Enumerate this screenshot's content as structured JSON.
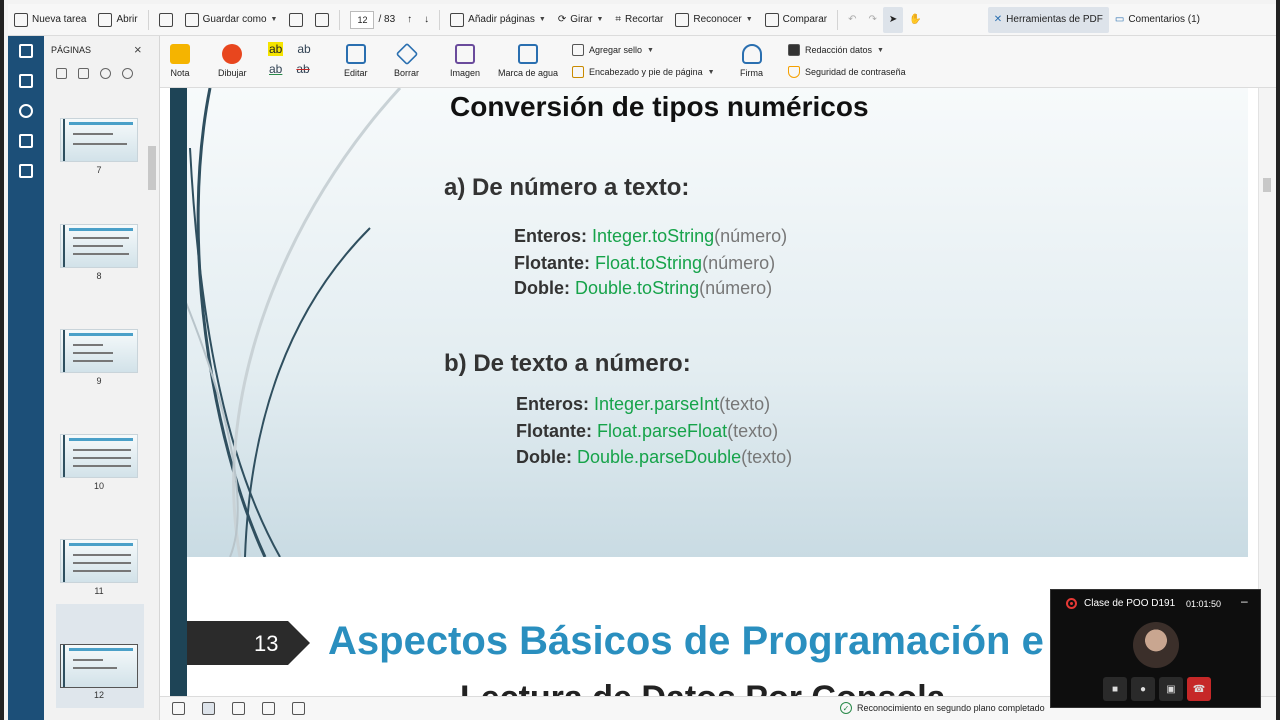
{
  "toolbar": {
    "new_task": "Nueva tarea",
    "open": "Abrir",
    "save_as": "Guardar como",
    "page_current": "12",
    "page_total": "/ 83",
    "add_pages": "Añadir páginas",
    "rotate": "Girar",
    "crop": "Recortar",
    "recognize": "Reconocer",
    "compare": "Comparar",
    "pdf_tools": "Herramientas de PDF",
    "comments": "Comentarios (1)"
  },
  "ribbon": {
    "note": "Nota",
    "draw": "Dibujar",
    "highlight_glyph": "ab",
    "edit": "Editar",
    "erase": "Borrar",
    "image": "Imagen",
    "watermark": "Marca de agua",
    "add_stamp": "Agregar sello",
    "header_footer": "Encabezado y pie de página",
    "signature": "Firma",
    "redaction": "Redacción datos",
    "password_security": "Seguridad de contraseña"
  },
  "panel": {
    "title": "PÁGINAS",
    "close": "×",
    "thumbnails": [
      "7",
      "8",
      "9",
      "10",
      "11",
      "12"
    ],
    "selected": "12"
  },
  "slide12": {
    "title": "Conversión de tipos numéricos",
    "section_a": "a) De número a texto:",
    "section_b": "b) De texto a número:",
    "a_lines": [
      {
        "label": "Enteros:",
        "fn": "Integer.toString",
        "arg": "(número)"
      },
      {
        "label": "Flotante:",
        "fn": "Float.toString",
        "arg": "(número)"
      },
      {
        "label": "Doble:",
        "fn": "Double.toString",
        "arg": "(número)"
      }
    ],
    "b_lines": [
      {
        "label": "Enteros:",
        "fn": "Integer.parseInt",
        "arg": "(texto)"
      },
      {
        "label": "Flotante:",
        "fn": "Float.parseFloat",
        "arg": "(texto)"
      },
      {
        "label": "Doble:",
        "fn": "Double.parseDouble",
        "arg": "(texto)"
      }
    ]
  },
  "slide13": {
    "number": "13",
    "title": "Aspectos Básicos de Programación e",
    "subtitle": "Lectura de Datos Por Consola"
  },
  "status": {
    "text": "Reconocimiento en segundo plano completado"
  },
  "meeting": {
    "title": "Clase de POO D191",
    "elapsed": "01:01:50",
    "minimize": "–"
  },
  "colors": {
    "rail": "#1c4f78",
    "code_green": "#16a34a",
    "slide13_title": "#2a8fbf",
    "end_call": "#c62828"
  }
}
